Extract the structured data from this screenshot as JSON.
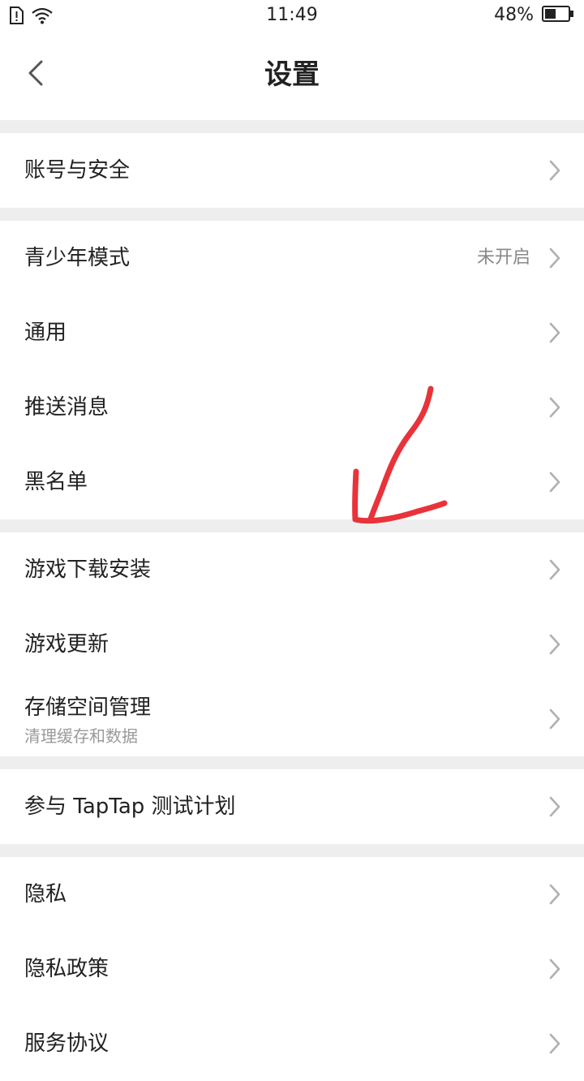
{
  "status_bar": {
    "time": "11:49",
    "battery_percent": "48%",
    "battery_level": 0.48,
    "icons": [
      "sim-alert-icon",
      "wifi-icon",
      "battery-icon"
    ]
  },
  "header": {
    "title": "设置",
    "back_icon": "chevron-left-icon"
  },
  "groups": [
    {
      "items": [
        {
          "label": "账号与安全"
        }
      ]
    },
    {
      "items": [
        {
          "label": "青少年模式",
          "value": "未开启"
        },
        {
          "label": "通用"
        },
        {
          "label": "推送消息"
        },
        {
          "label": "黑名单"
        }
      ]
    },
    {
      "items": [
        {
          "label": "游戏下载安装"
        },
        {
          "label": "游戏更新"
        },
        {
          "label": "存储空间管理",
          "subtitle": "清理缓存和数据"
        }
      ]
    },
    {
      "items": [
        {
          "label": "参与 TapTap 测试计划"
        }
      ]
    },
    {
      "items": [
        {
          "label": "隐私"
        },
        {
          "label": "隐私政策"
        },
        {
          "label": "服务协议"
        }
      ]
    }
  ],
  "colors": {
    "background": "#ffffff",
    "divider": "#eeeeee",
    "text": "#222222",
    "secondary_text": "#888888",
    "chevron": "#b0b0b0",
    "annotation": "#e8333a"
  }
}
